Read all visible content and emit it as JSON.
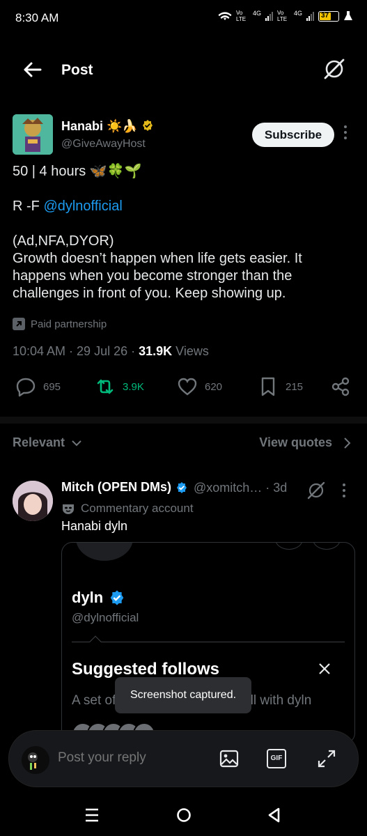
{
  "status": {
    "time": "8:30 AM",
    "lte1": "Vo LTE",
    "lte2": "Vo LTE",
    "net": "4G",
    "battery": "37"
  },
  "header": {
    "title": "Post"
  },
  "post": {
    "author_name": "Hanabi ☀️🍌",
    "author_handle": "@GiveAwayHost",
    "subscribe_label": "Subscribe",
    "line1": "50 | 4 hours 🦋🍀🌱",
    "line2_prefix": "R -F ",
    "line2_mention": "@dylnofficial",
    "line3": "(Ad,NFA,DYOR)",
    "body": "Growth doesn’t happen when life gets easier. It happens when you become stronger than the challenges in front of you. Keep showing up.",
    "paid": "Paid partnership",
    "time": "10:04 AM · 29 Jul 26 · ",
    "views_count": "31.9K",
    "views_label": " Views"
  },
  "actions": {
    "replies": "695",
    "reposts": "3.9K",
    "likes": "620",
    "bookmarks": "215"
  },
  "sort": {
    "relevant": "Relevant",
    "view_quotes": "View quotes"
  },
  "reply": {
    "name": "Mitch (OPEN DMs)",
    "handle": "@xomitch… · 3d",
    "commentary": "Commentary account",
    "text": "Hanabi dyln",
    "card": {
      "name": "dyln",
      "handle": "@dylnofficial",
      "suggested": "Suggested follows",
      "desc": "A set of accounts that work well with dyln"
    }
  },
  "toast": "Screenshot captured.",
  "composer": {
    "placeholder": "Post your reply",
    "gif": "GIF"
  },
  "colors": {
    "accent": "#1d9bf0",
    "repost": "#00ba7c",
    "bg": "#000000"
  }
}
